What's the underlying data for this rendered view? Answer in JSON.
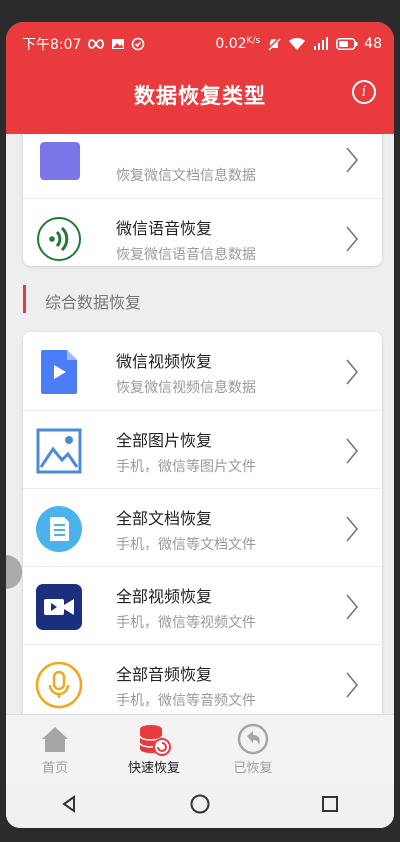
{
  "status_bar": {
    "time": "下午8:07",
    "speed": "0.02",
    "speed_unit": "K/s",
    "battery": "48"
  },
  "header": {
    "title": "数据恢复类型",
    "info_label": "i"
  },
  "partial_card": [
    {
      "title": "",
      "subtitle": "恢复微信文档信息数据"
    },
    {
      "title": "微信语音恢复",
      "subtitle": "恢复微信语音信息数据"
    }
  ],
  "section": {
    "title": "综合数据恢复"
  },
  "items": [
    {
      "title": "微信视频恢复",
      "subtitle": "恢复微信视频信息数据"
    },
    {
      "title": "全部图片恢复",
      "subtitle": "手机，微信等图片文件"
    },
    {
      "title": "全部文档恢复",
      "subtitle": "手机，微信等文档文件"
    },
    {
      "title": "全部视频恢复",
      "subtitle": "手机，微信等视频文件"
    },
    {
      "title": "全部音频恢复",
      "subtitle": "手机，微信等音频文件"
    }
  ],
  "tabs": [
    {
      "label": "首页",
      "active": false
    },
    {
      "label": "快速恢复",
      "active": true
    },
    {
      "label": "已恢复",
      "active": false
    }
  ],
  "colors": {
    "accent": "#e93a3d",
    "tab_inactive": "#9e9e9e",
    "tab_active": "#222222"
  }
}
